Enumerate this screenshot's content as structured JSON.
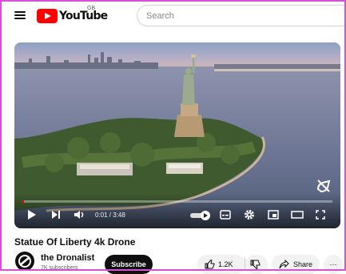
{
  "header": {
    "logo_text": "YouTube",
    "country_code": "GB",
    "search_placeholder": "Search"
  },
  "player": {
    "time_display": "0:01 / 3:48",
    "progress_fraction": 0.003,
    "autoplay": "on"
  },
  "video": {
    "title": "Statue Of Liberty 4k Drone"
  },
  "channel": {
    "name": "the Dronalist",
    "subscribers": "7K subscribers",
    "subscribe_label": "Subscribe"
  },
  "actions": {
    "like_count": "1.2K",
    "share_label": "Share",
    "more_label": "···"
  },
  "colors": {
    "brand_red": "#ff0000",
    "subscribe_bg": "#0f0f0f",
    "pill_bg": "#f2f2f2"
  },
  "icons": [
    "menu-icon",
    "youtube-logo-icon",
    "play-icon",
    "next-icon",
    "volume-icon",
    "autoplay-toggle-icon",
    "captions-icon",
    "settings-icon",
    "miniplayer-icon",
    "theater-icon",
    "fullscreen-icon",
    "no-cast-icon",
    "like-icon",
    "dislike-icon",
    "share-icon",
    "more-icon"
  ]
}
